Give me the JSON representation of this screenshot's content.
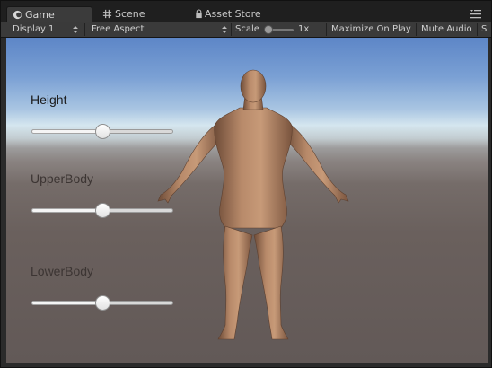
{
  "tabs": {
    "game": "Game",
    "scene": "Scene",
    "asset_store": "Asset Store"
  },
  "toolbar": {
    "display": "Display 1",
    "aspect": "Free Aspect",
    "scale_label": "Scale",
    "scale_value": "1x",
    "maximize": "Maximize On Play",
    "mute": "Mute Audio",
    "stats_partial": "S"
  },
  "sliders": [
    {
      "label": "Height",
      "value": 0.5
    },
    {
      "label": "UpperBody",
      "value": 0.5
    },
    {
      "label": "LowerBody",
      "value": 0.5
    }
  ],
  "colors": {
    "label_active": "#1a1a1a",
    "label_dim": "#3c3533",
    "skin": "#b48363"
  },
  "icons": {
    "game_tab": "unity-logo-icon",
    "scene_tab": "grid-icon",
    "asset_store_tab": "lock-icon",
    "menu": "hamburger-menu-icon"
  }
}
